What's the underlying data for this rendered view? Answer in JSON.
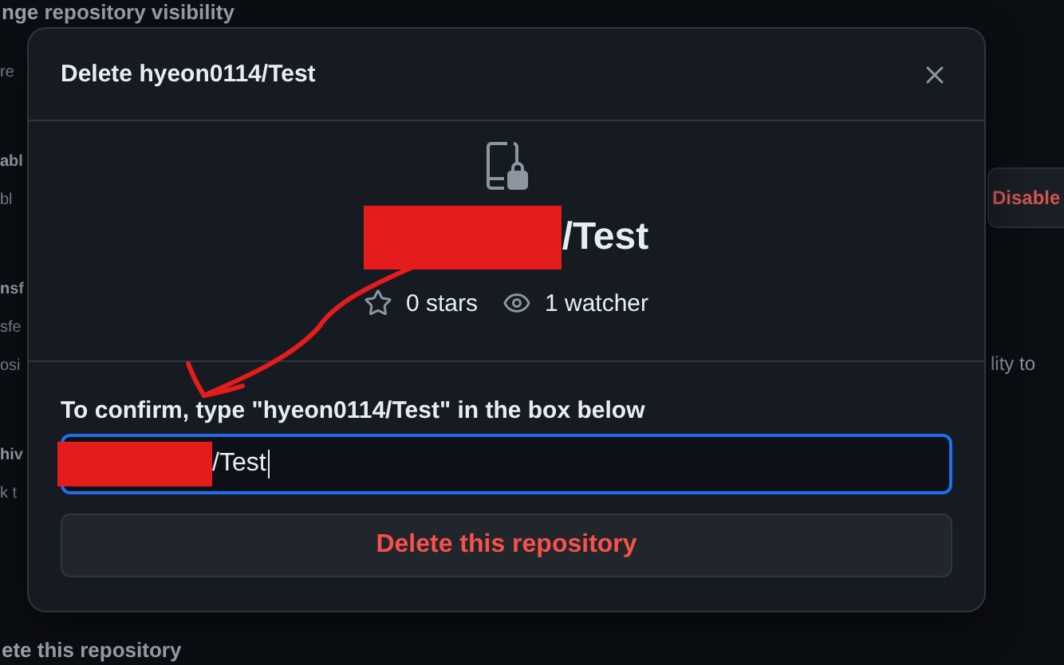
{
  "background": {
    "left": [
      {
        "text": "nge repository visibility",
        "kind": "heading"
      },
      {
        "text": "re",
        "kind": "note"
      },
      {
        "text": "abl",
        "kind": "heading"
      },
      {
        "text": "bl",
        "kind": "note"
      },
      {
        "text": "nsf",
        "kind": "heading"
      },
      {
        "text": "sfe",
        "kind": "note"
      },
      {
        "text": "osi",
        "kind": "note"
      },
      {
        "text": "hiv",
        "kind": "heading"
      },
      {
        "text": "k t",
        "kind": "note"
      },
      {
        "text": "ete this repository",
        "kind": "heading"
      }
    ],
    "right_button": "Disable",
    "right_text": "lity to"
  },
  "dialog": {
    "title": "Delete hyeon0114/Test",
    "repo": {
      "suffix": "/Test",
      "redacted": true
    },
    "stars": "0 stars",
    "watchers": "1 watcher",
    "confirm_label": "To confirm, type \"hyeon0114/Test\" in the box below",
    "input": {
      "value": "/Test",
      "redacted": true,
      "focused": true
    },
    "delete_button": "Delete this repository"
  },
  "annotation": {
    "arrow": true
  }
}
